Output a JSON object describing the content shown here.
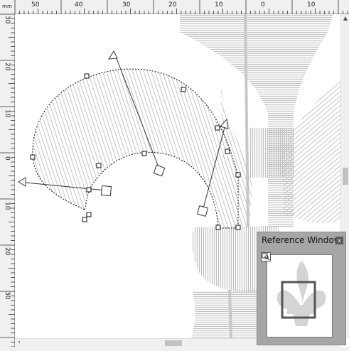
{
  "ruler": {
    "unit": "mm",
    "top_labels": [
      "50",
      "40",
      "30",
      "20",
      "10",
      "0",
      "10"
    ],
    "left_labels": [
      "30",
      "20",
      "10",
      "0",
      "10",
      "20",
      "30"
    ]
  },
  "reference_window": {
    "title": "Reference Window",
    "close_label": "x"
  },
  "colors": {
    "ruler_bg": "#f0f0f0",
    "stitch": "#c0c0c0",
    "panel_bg": "#a6a6a6",
    "view_frame": "#555555"
  },
  "icons": {
    "scroll_left": "‹",
    "scroll_up": "▲",
    "close": "close-icon",
    "zoom": "zoom-icon"
  }
}
